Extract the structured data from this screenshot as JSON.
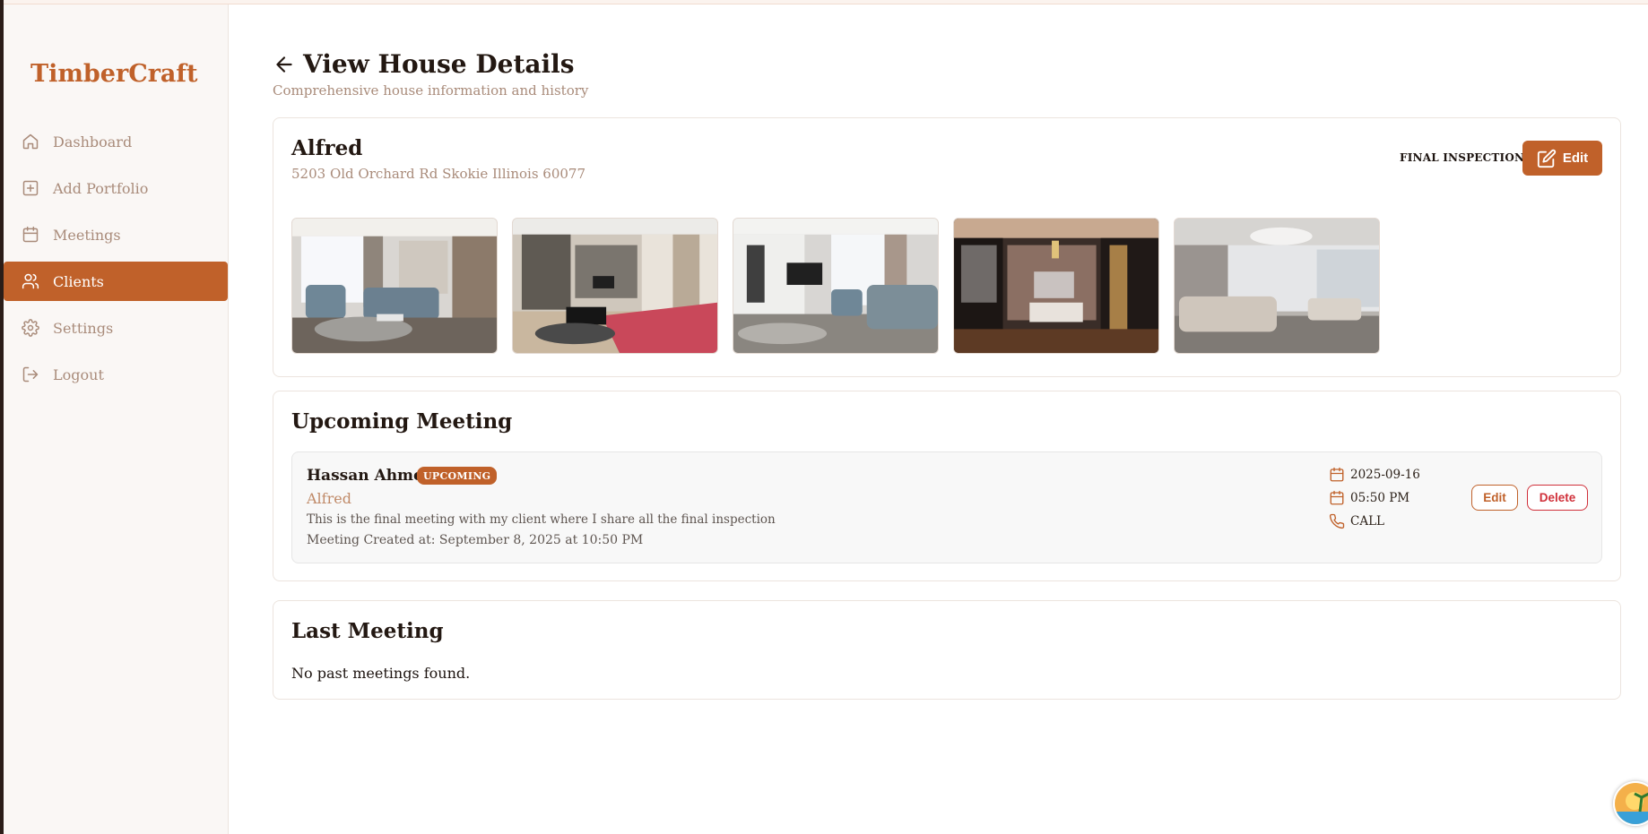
{
  "brand": "TimberCraft",
  "nav": [
    {
      "label": "Dashboard",
      "icon": "home-icon",
      "active": false
    },
    {
      "label": "Add Portfolio",
      "icon": "plus-square-icon",
      "active": false
    },
    {
      "label": "Meetings",
      "icon": "calendar-icon",
      "active": false
    },
    {
      "label": "Clients",
      "icon": "users-icon",
      "active": true
    },
    {
      "label": "Settings",
      "icon": "gear-icon",
      "active": false
    },
    {
      "label": "Logout",
      "icon": "logout-icon",
      "active": false
    }
  ],
  "page": {
    "title": "View House Details",
    "subtitle": "Comprehensive house information and history"
  },
  "house": {
    "name": "Alfred",
    "address": "5203 Old Orchard Rd Skokie Illinois 60077",
    "status": "FINAL INSPECTION",
    "edit_label": "Edit",
    "photos": [
      "living-room-photo",
      "living-room-red-sofa-photo",
      "living-room-fireplace-photo",
      "bedroom-photo",
      "penthouse-lounge-photo"
    ]
  },
  "upcoming": {
    "section_title": "Upcoming Meeting",
    "client_name": "Hassan Ahmed",
    "badge": "UPCOMING",
    "house_name": "Alfred",
    "description": "This is the final meeting with my client where I share all the final inspection",
    "created": "Meeting Created at: September 8, 2025 at 10:50 PM",
    "date": "2025-09-16",
    "time": "05:50 PM",
    "type": "CALL",
    "edit_label": "Edit",
    "delete_label": "Delete"
  },
  "last": {
    "section_title": "Last Meeting",
    "empty_text": "No past meetings found."
  },
  "colors": {
    "accent": "#c0612a",
    "muted_text": "#a98b7a",
    "danger": "#d0303a"
  }
}
